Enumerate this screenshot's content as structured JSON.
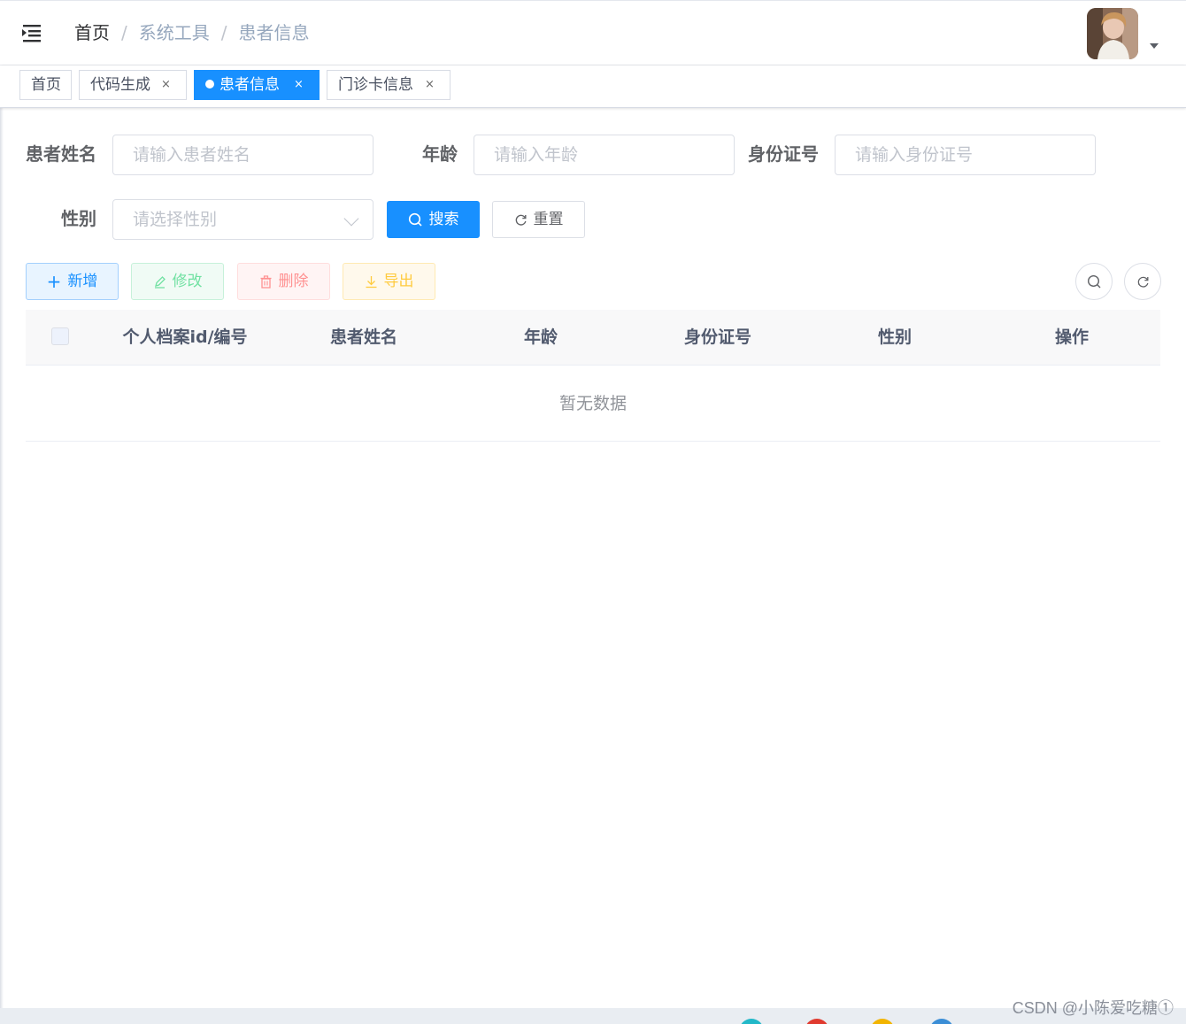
{
  "breadcrumb": {
    "home": "首页",
    "separator": "/",
    "level1": "系统工具",
    "current": "患者信息"
  },
  "tags": {
    "home": "首页",
    "codegen": "代码生成",
    "patient": "患者信息",
    "clinic_card": "门诊卡信息",
    "close": "×"
  },
  "form": {
    "name_label": "患者姓名",
    "name_placeholder": "请输入患者姓名",
    "age_label": "年龄",
    "age_placeholder": "请输入年龄",
    "idcard_label": "身份证号",
    "idcard_placeholder": "请输入身份证号",
    "gender_label": "性别",
    "gender_placeholder": "请选择性别",
    "search_label": "搜索",
    "reset_label": "重置"
  },
  "toolbar": {
    "add_label": "新增",
    "edit_label": "修改",
    "delete_label": "删除",
    "export_label": "导出"
  },
  "table": {
    "columns": [
      "个人档案id/编号",
      "患者姓名",
      "年龄",
      "身份证号",
      "性别",
      "操作"
    ],
    "empty_text": "暂无数据"
  },
  "watermark": "CSDN @小陈爱吃糖①",
  "colors": {
    "primary": "#1890ff",
    "success": "#13ce66",
    "danger": "#ff4949",
    "warning": "#ffba00"
  }
}
